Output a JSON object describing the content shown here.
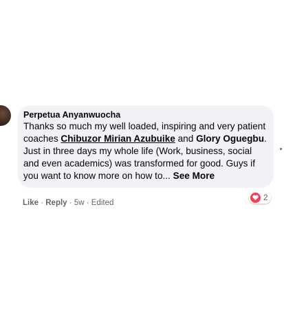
{
  "comment": {
    "author": "Perpetua Anyanwuocha",
    "text_before": "Thanks so much my well loaded, inspiring and very patient coaches ",
    "mention_1": "Chibuzor Mirian Azubuike",
    "text_middle": " and ",
    "mention_2": "Glory Oguegbu",
    "text_after": ". Just in three days my whole life (Work, business, social and even academics) was transformed for good. Guys if you want to know more on how to... ",
    "see_more": "See More",
    "reaction_count": "2",
    "actions": {
      "like": "Like",
      "separator": " · ",
      "reply": "Reply",
      "time": "5w",
      "edited": "Edited"
    }
  },
  "colors": {
    "bubble": "#f0f2f5",
    "love": "#f33e58",
    "meta": "#65676b"
  }
}
